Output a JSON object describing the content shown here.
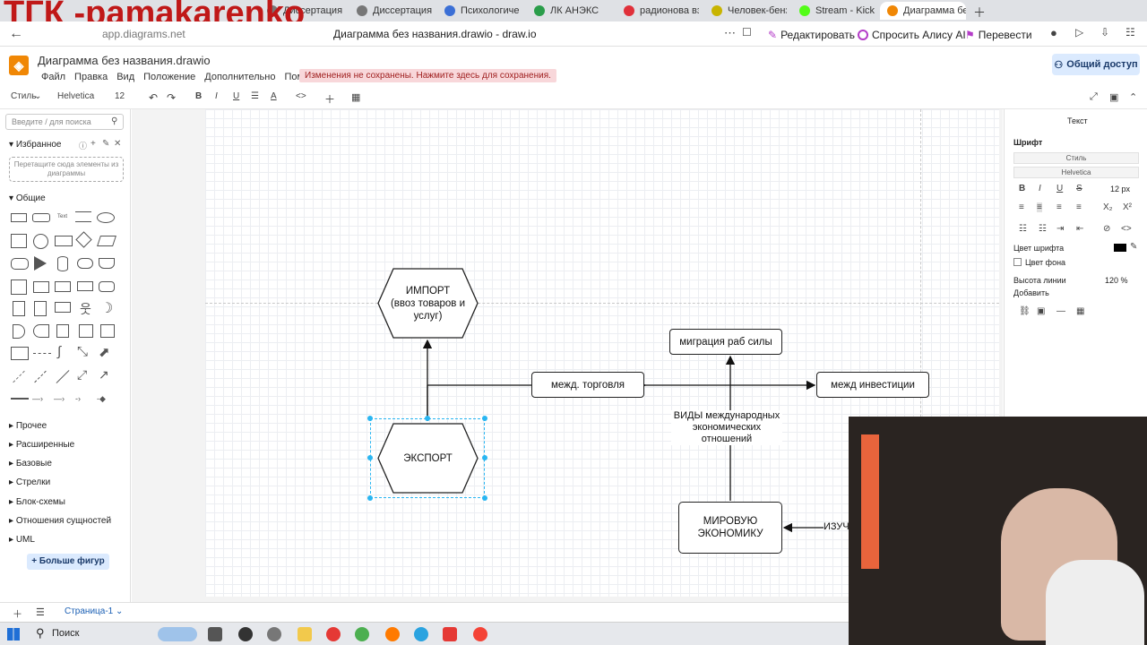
{
  "overlay_title": "ТГК -pamakarenko",
  "browser": {
    "tabs": [
      {
        "label": "Диссертация на"
      },
      {
        "label": "Диссертация на"
      },
      {
        "label": "Психологически"
      },
      {
        "label": "ЛК АНЭКС"
      },
      {
        "label": "радионова взаи"
      },
      {
        "label": "Человек-бензоп"
      },
      {
        "label": "Stream - Kick Das"
      },
      {
        "label": "Диаграмма бе"
      }
    ],
    "url": "app.diagrams.net",
    "page_title": "Диаграмма без названия.drawio - draw.io",
    "actions": {
      "edit": "Редактировать",
      "alice": "Спросить Алису AI",
      "translate": "Перевести"
    }
  },
  "app": {
    "logo": "◈",
    "doc_title": "Диаграмма без названия.drawio",
    "menu": [
      "Файл",
      "Правка",
      "Вид",
      "Положение",
      "Дополнительно",
      "Помощь"
    ],
    "unsaved_notice": "Изменения не сохранены. Нажмите здесь для сохранения.",
    "share_label": "Общий доступ"
  },
  "toolbar": {
    "style": "Стиль",
    "font": "Helvetica",
    "size": "12"
  },
  "left_panel": {
    "search_placeholder": "Введите / для поиска",
    "favorites": "Избранное",
    "favorites_drop": "Перетащите сюда элементы из диаграммы",
    "general": "Общие",
    "categories": [
      "Прочее",
      "Расширенные",
      "Базовые",
      "Стрелки",
      "Блок-схемы",
      "Отношения сущностей",
      "UML"
    ],
    "more_shapes": "Больше фигур"
  },
  "diagram": {
    "import_line1": "ИМПОРТ",
    "import_line2": "(ввоз товаров и",
    "import_line3": "услуг)",
    "export": "ЭКСПОРТ",
    "trade": "межд. торговля",
    "invest": "межд ин­вестиции",
    "migration": "миграция  раб силы",
    "types_line1": "ВИДЫ международных",
    "types_line2": "экономических",
    "types_line3": "отношений",
    "world_line1": "МИРОВУЮ",
    "world_line2": "ЭКОНОМИКУ",
    "study": "ИЗУЧ"
  },
  "right_panel": {
    "tab": "Текст",
    "font_section": "Шрифт",
    "style": "Стиль",
    "font": "Helvetica",
    "font_size": "12 px",
    "font_color": "Цвет шрифта",
    "bg_color": "Цвет фона",
    "line_height_label": "Высота линии",
    "line_height": "120 %",
    "add": "Добавить"
  },
  "pagebar": {
    "page": "Страница-1"
  },
  "taskbar": {
    "search": "Поиск"
  },
  "colors": {
    "accent": "#f08705",
    "selection": "#29b6f2",
    "share_bg": "#dbeafe",
    "unsaved_bg": "#f8d7da"
  }
}
